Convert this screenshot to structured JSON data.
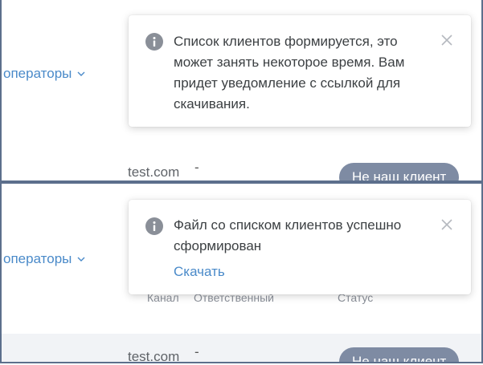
{
  "panels": [
    {
      "operators_label": "операторы",
      "toast": {
        "message": "Список клиентов формируется, это может занять некоторое время. Вам придет уведомление с ссылкой для скачивания."
      },
      "row": {
        "site": "test.com",
        "dash": "-",
        "status_tag": "Не наш клиент"
      }
    },
    {
      "operators_label": "операторы",
      "toast": {
        "message": "Файл со списком клиентов успешно сформирован",
        "link": "Скачать"
      },
      "columns": [
        "Канал",
        "Ответственный",
        "Статус"
      ],
      "row": {
        "site": "test.com",
        "dash": "-",
        "status_tag": "Не наш клиент"
      }
    }
  ],
  "colors": {
    "accent": "#4a8ac9",
    "tag_bg": "#7e8ba3",
    "frame": "#5c6f8c",
    "icon_grey": "#8a8f98"
  },
  "icons": [
    "info-icon",
    "close-icon",
    "chevron-down-icon"
  ]
}
